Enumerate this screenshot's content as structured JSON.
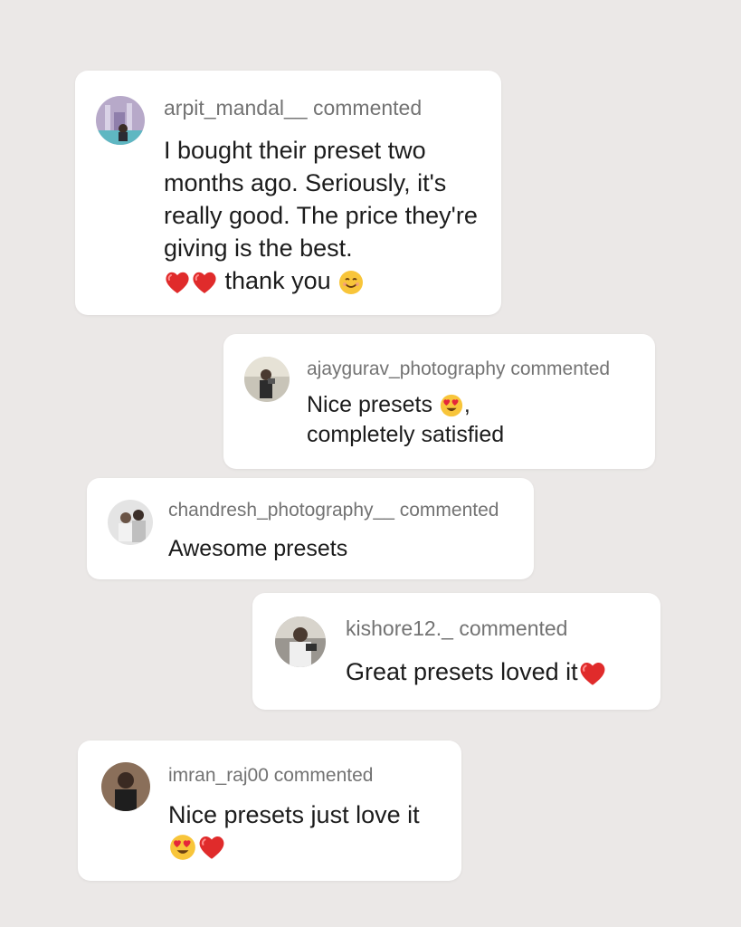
{
  "background_color": "#ebe8e7",
  "comment_suffix": "commented",
  "comments": [
    {
      "username": "arpit_mandal__",
      "text": "I bought their preset two months ago. Seriously, it's really good. The price they're giving is the best.",
      "trailing_text": "thank you",
      "emojis_before": [
        "red-heart",
        "red-heart"
      ],
      "emojis_after": [
        "smiling-face"
      ]
    },
    {
      "username": "ajaygurav_photography",
      "text": "Nice presets",
      "trailing_text": "completely satisfied",
      "emojis": [
        "heart-eyes-face"
      ]
    },
    {
      "username": "chandresh_photography__",
      "text": "Awesome presets"
    },
    {
      "username": "kishore12._",
      "text": "Great presets loved it",
      "emojis": [
        "red-heart"
      ]
    },
    {
      "username": "imran_raj00",
      "text": "Nice presets just love it",
      "emojis": [
        "heart-eyes-face",
        "red-heart"
      ]
    }
  ]
}
